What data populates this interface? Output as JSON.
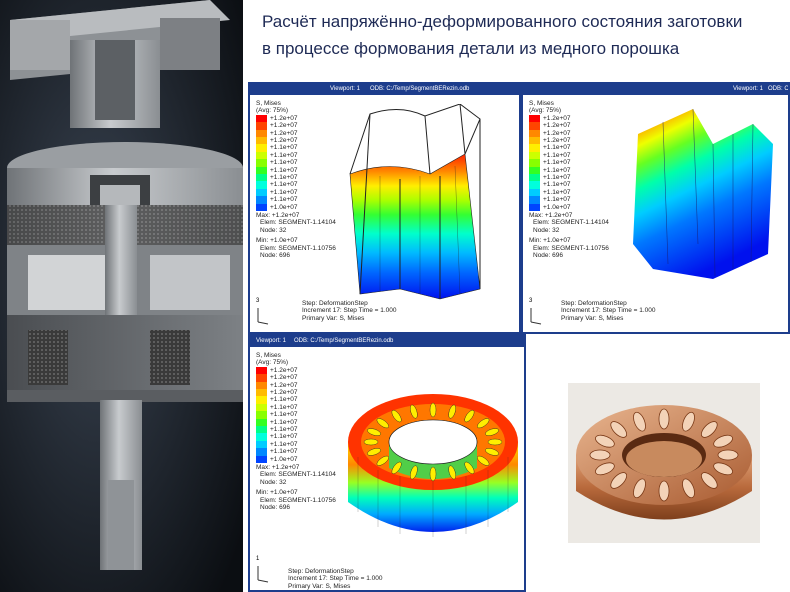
{
  "title": {
    "line1": "Расчёт напряжённо-деформированного состояния заготовки",
    "line2": "в процессе формования детали из медного порошка"
  },
  "colors": {
    "title_text": "#1e2a55",
    "viewport_frame": "#1d3d8c",
    "left_background": "#0f1216",
    "copper": "#c77a45"
  },
  "contour_colors": [
    "#ff0000",
    "#ff4400",
    "#ff8800",
    "#ffbb00",
    "#ffee00",
    "#ccff00",
    "#88ff00",
    "#33ff22",
    "#00ff88",
    "#00ffdd",
    "#00ccff",
    "#0088ff",
    "#0044ff",
    "#0000ee"
  ],
  "viewports": [
    {
      "header_viewport": "Viewport: 1",
      "header_odb": "ODB: C:/Temp/SegmentBERezin.odb",
      "legend_title": "S, Mises",
      "legend_avg": "(Avg: 75%)",
      "legend_values": [
        "+1.2e+07",
        "+1.2e+07",
        "+1.2e+07",
        "+1.2e+07",
        "+1.1e+07",
        "+1.1e+07",
        "+1.1e+07",
        "+1.1e+07",
        "+1.1e+07",
        "+1.1e+07",
        "+1.1e+07",
        "+1.1e+07",
        "+1.0e+07"
      ],
      "max_label": "Max: +1.2e+07",
      "max_elem": "Elem: SEGMENT-1.14104",
      "max_node": "Node: 32",
      "min_label": "Min: +1.0e+07",
      "min_elem": "Elem: SEGMENT-1.10756",
      "min_node": "Node: 696",
      "step": "Step: DeformationStep",
      "increment": "Increment    17: Step Time =    1.000",
      "primary_var": "Primary Var: S, Mises",
      "axis_label": "3"
    },
    {
      "header_viewport": "Viewport: 1",
      "header_odb": "ODB: C:/Temp/SegmentBERezin.odb",
      "legend_title": "S, Mises",
      "legend_avg": "(Avg: 75%)",
      "legend_values": [
        "+1.2e+07",
        "+1.2e+07",
        "+1.2e+07",
        "+1.2e+07",
        "+1.1e+07",
        "+1.1e+07",
        "+1.1e+07",
        "+1.1e+07",
        "+1.1e+07",
        "+1.1e+07",
        "+1.1e+07",
        "+1.1e+07",
        "+1.0e+07"
      ],
      "max_label": "Max: +1.2e+07",
      "max_elem": "Elem: SEGMENT-1.14104",
      "max_node": "Node: 32",
      "min_label": "Min: +1.0e+07",
      "min_elem": "Elem: SEGMENT-1.10756",
      "min_node": "Node: 696",
      "step": "Step: DeformationStep",
      "increment": "Increment    17: Step Time =    1.000",
      "primary_var": "Primary Var: S, Mises",
      "axis_label": "3"
    },
    {
      "header_viewport": "Viewport: 1",
      "header_odb": "ODB: C:/Temp/SegmentBERezin.odb",
      "legend_title": "S, Mises",
      "legend_avg": "(Avg: 75%)",
      "legend_values": [
        "+1.2e+07",
        "+1.2e+07",
        "+1.2e+07",
        "+1.2e+07",
        "+1.1e+07",
        "+1.1e+07",
        "+1.1e+07",
        "+1.1e+07",
        "+1.1e+07",
        "+1.1e+07",
        "+1.1e+07",
        "+1.1e+07",
        "+1.0e+07"
      ],
      "max_label": "Max: +1.2e+07",
      "max_elem": "Elem: SEGMENT-1.14104",
      "max_node": "Node: 32",
      "min_label": "Min: +1.0e+07",
      "min_elem": "Elem: SEGMENT-1.10756",
      "min_node": "Node: 696",
      "step": "Step: DeformationStep",
      "increment": "Increment    17: Step Time =    1.000",
      "primary_var": "Primary Var: S, Mises",
      "axis_label": "1"
    }
  ]
}
